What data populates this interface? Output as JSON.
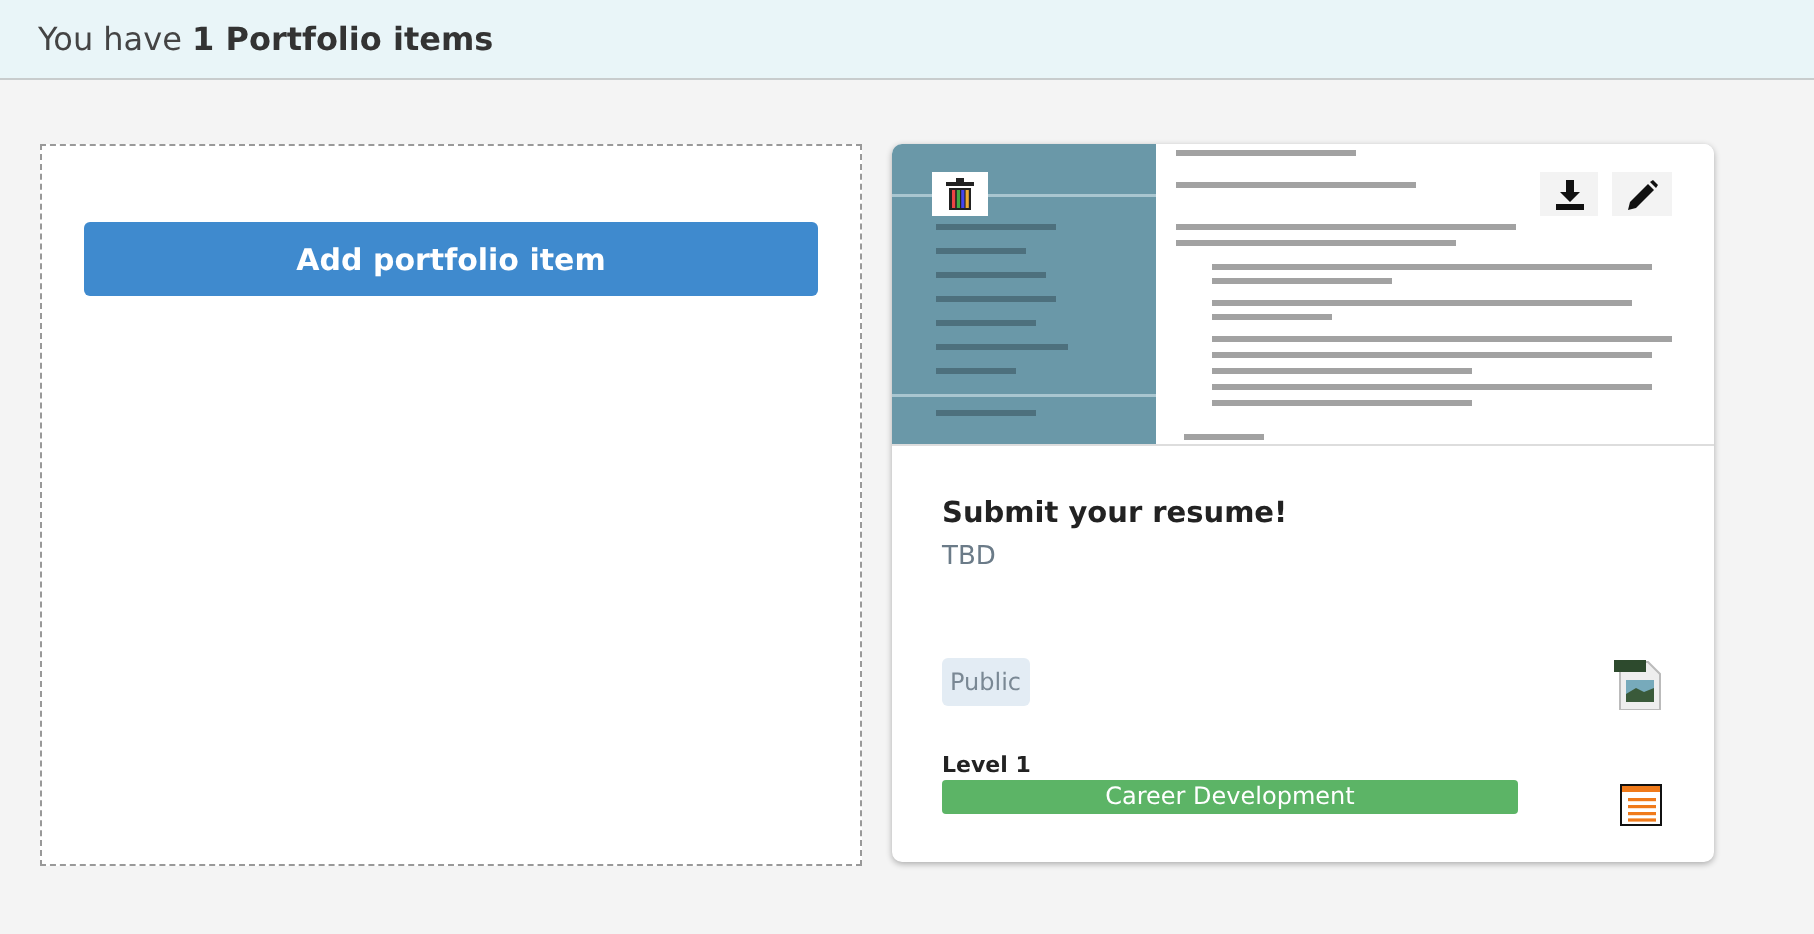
{
  "header": {
    "title": "You have **1 Portfolio items**"
  },
  "add_button": {
    "label": "Add portfolio item"
  },
  "items": [
    {
      "title": "Submit your resume!",
      "description": "TBD",
      "visibility": "Public",
      "level": "Level 1",
      "category": "Career Development"
    }
  ]
}
